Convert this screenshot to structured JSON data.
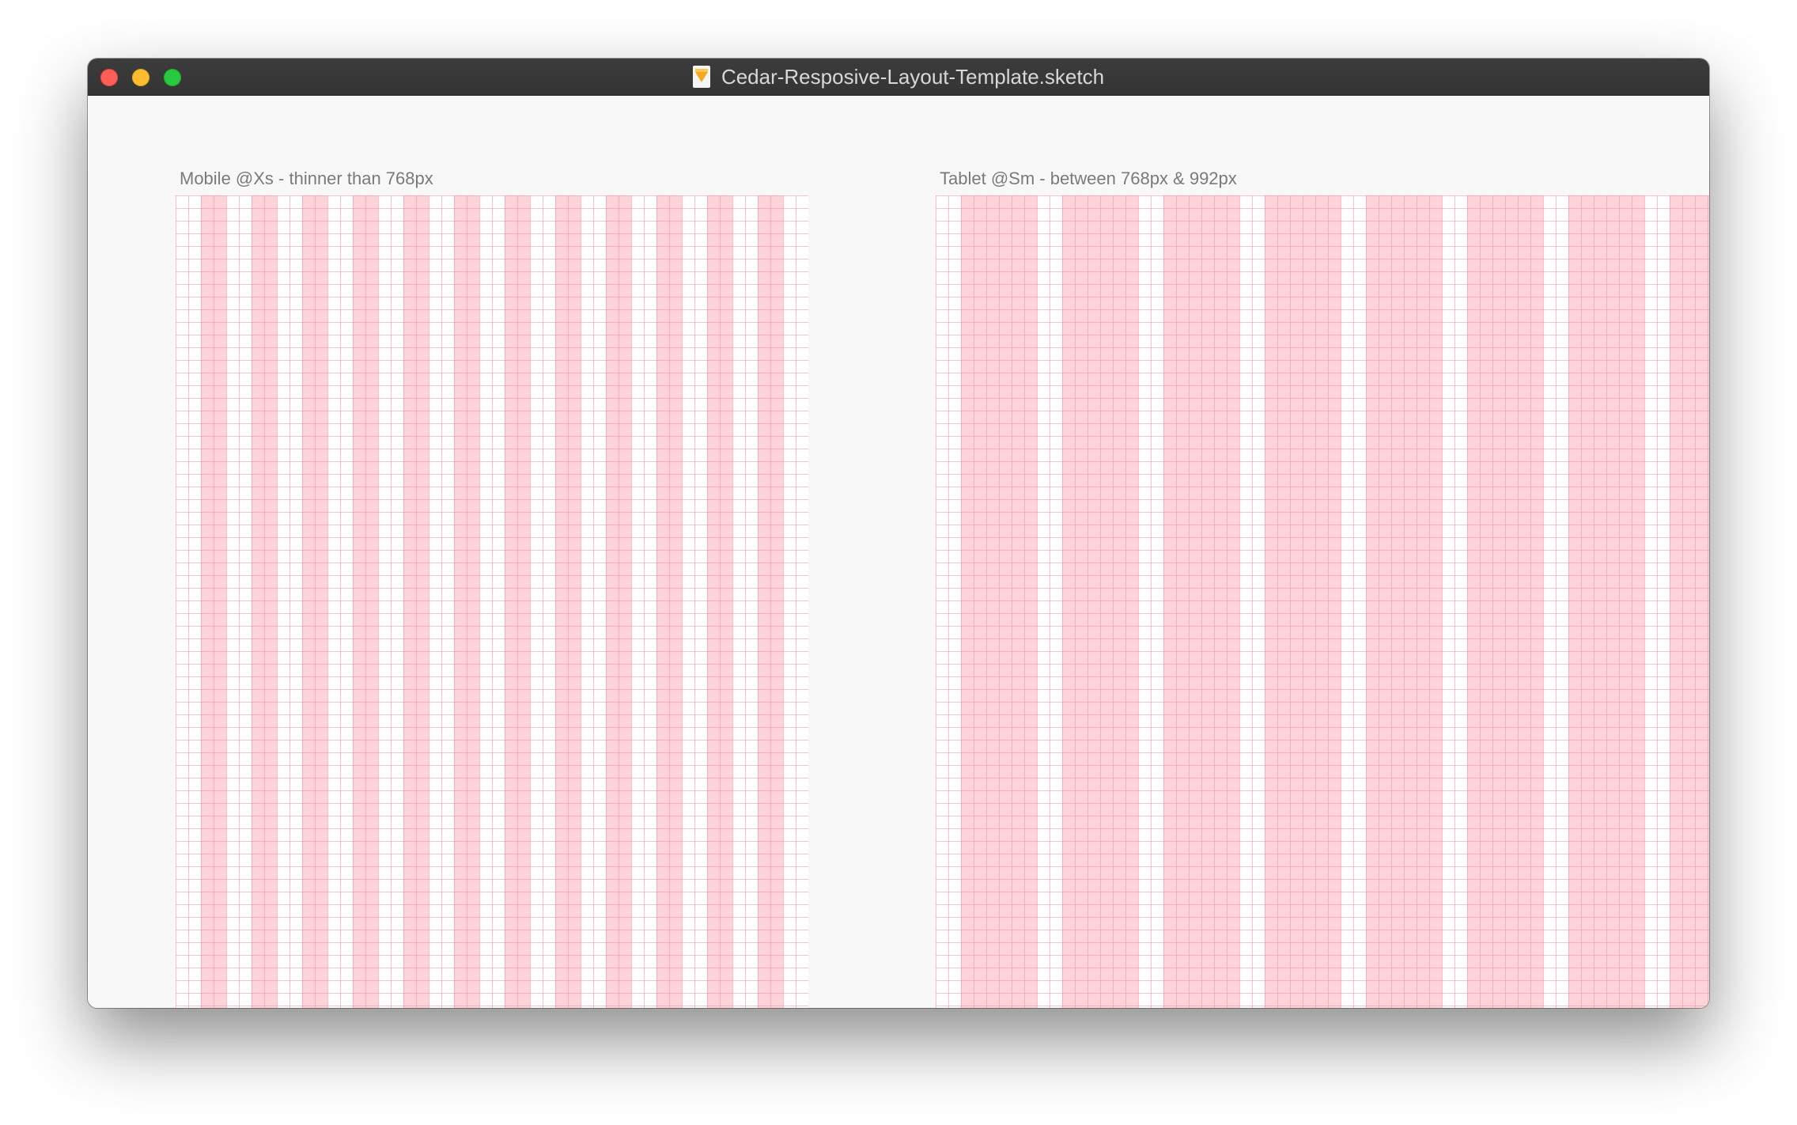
{
  "window": {
    "title": "Cedar-Resposive-Layout-Template.sketch",
    "document_icon": "sketch-file-icon"
  },
  "traffic_lights": {
    "close_color": "#fe5f57",
    "minimize_color": "#febc2e",
    "zoom_color": "#28c840"
  },
  "artboards": [
    {
      "label": "Mobile @Xs - thinner than 768px"
    },
    {
      "label": "Tablet @Sm - between 768px & 992px"
    }
  ],
  "colors": {
    "grid_line": "#fc8ca0",
    "column_fill": "#ffcdd2",
    "canvas_background": "#f8f8f8"
  }
}
